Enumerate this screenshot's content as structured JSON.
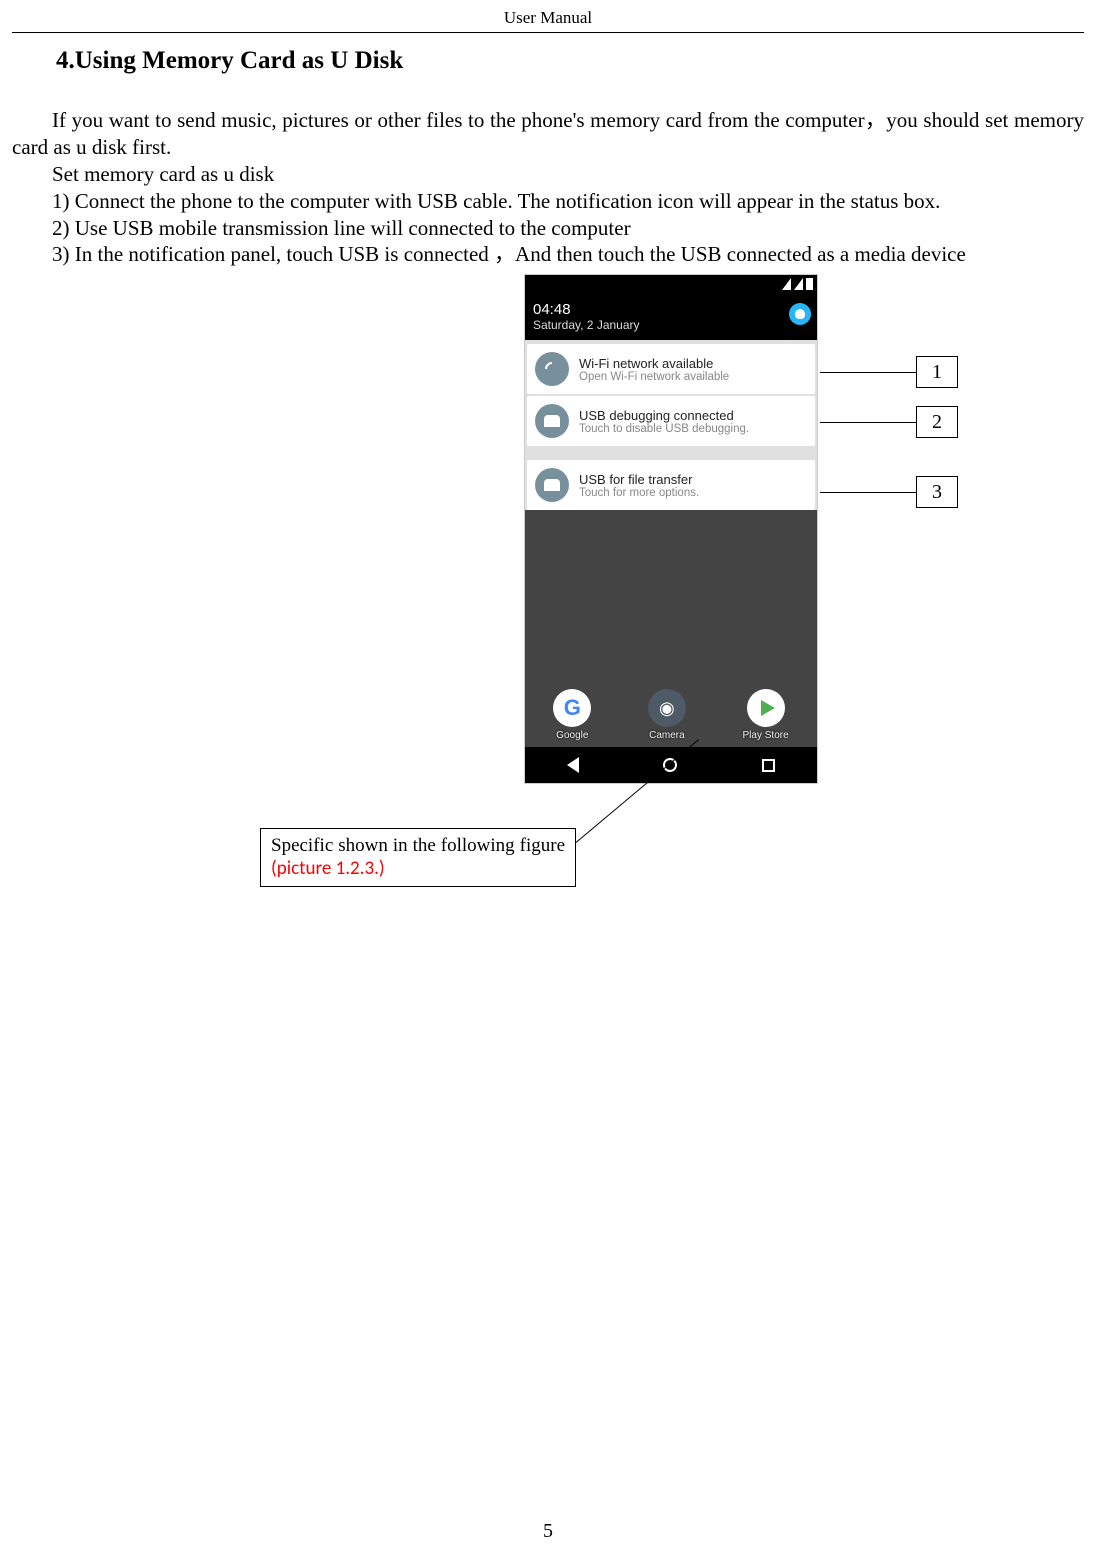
{
  "header": {
    "title": "User    Manual"
  },
  "section": {
    "title": "4.Using Memory Card as U Disk"
  },
  "body": {
    "p1": "If you want to send music, pictures or other files to the phone's memory card from the computer，you should set memory card as u disk first.",
    "p2": "Set memory card as u disk",
    "p3": "1) Connect the phone to the computer with USB cable. The notification icon will appear in the status box.",
    "p4": "2) Use USB mobile transmission line will connected to the computer",
    "p5": "3) In the notification panel, touch USB is connected  ，And then touch the USB connected as a media device"
  },
  "phone": {
    "time": "04:48",
    "date": "Saturday, 2 January",
    "notifications": [
      {
        "title": "Wi-Fi network available",
        "sub": "Open Wi-Fi network available"
      },
      {
        "title": "USB debugging connected",
        "sub": "Touch to disable USB debugging."
      },
      {
        "title": "USB for file transfer",
        "sub": "Touch for more options."
      }
    ],
    "apps": {
      "google": "Google",
      "camera": "Camera",
      "play": "Play Store"
    }
  },
  "callouts": {
    "c1": "1",
    "c2": "2",
    "c3": "3"
  },
  "annotation": {
    "prefix": "Specific   shown   in   the   following figure    ",
    "red": "(picture 1.2.3.)"
  },
  "page_number": "5"
}
